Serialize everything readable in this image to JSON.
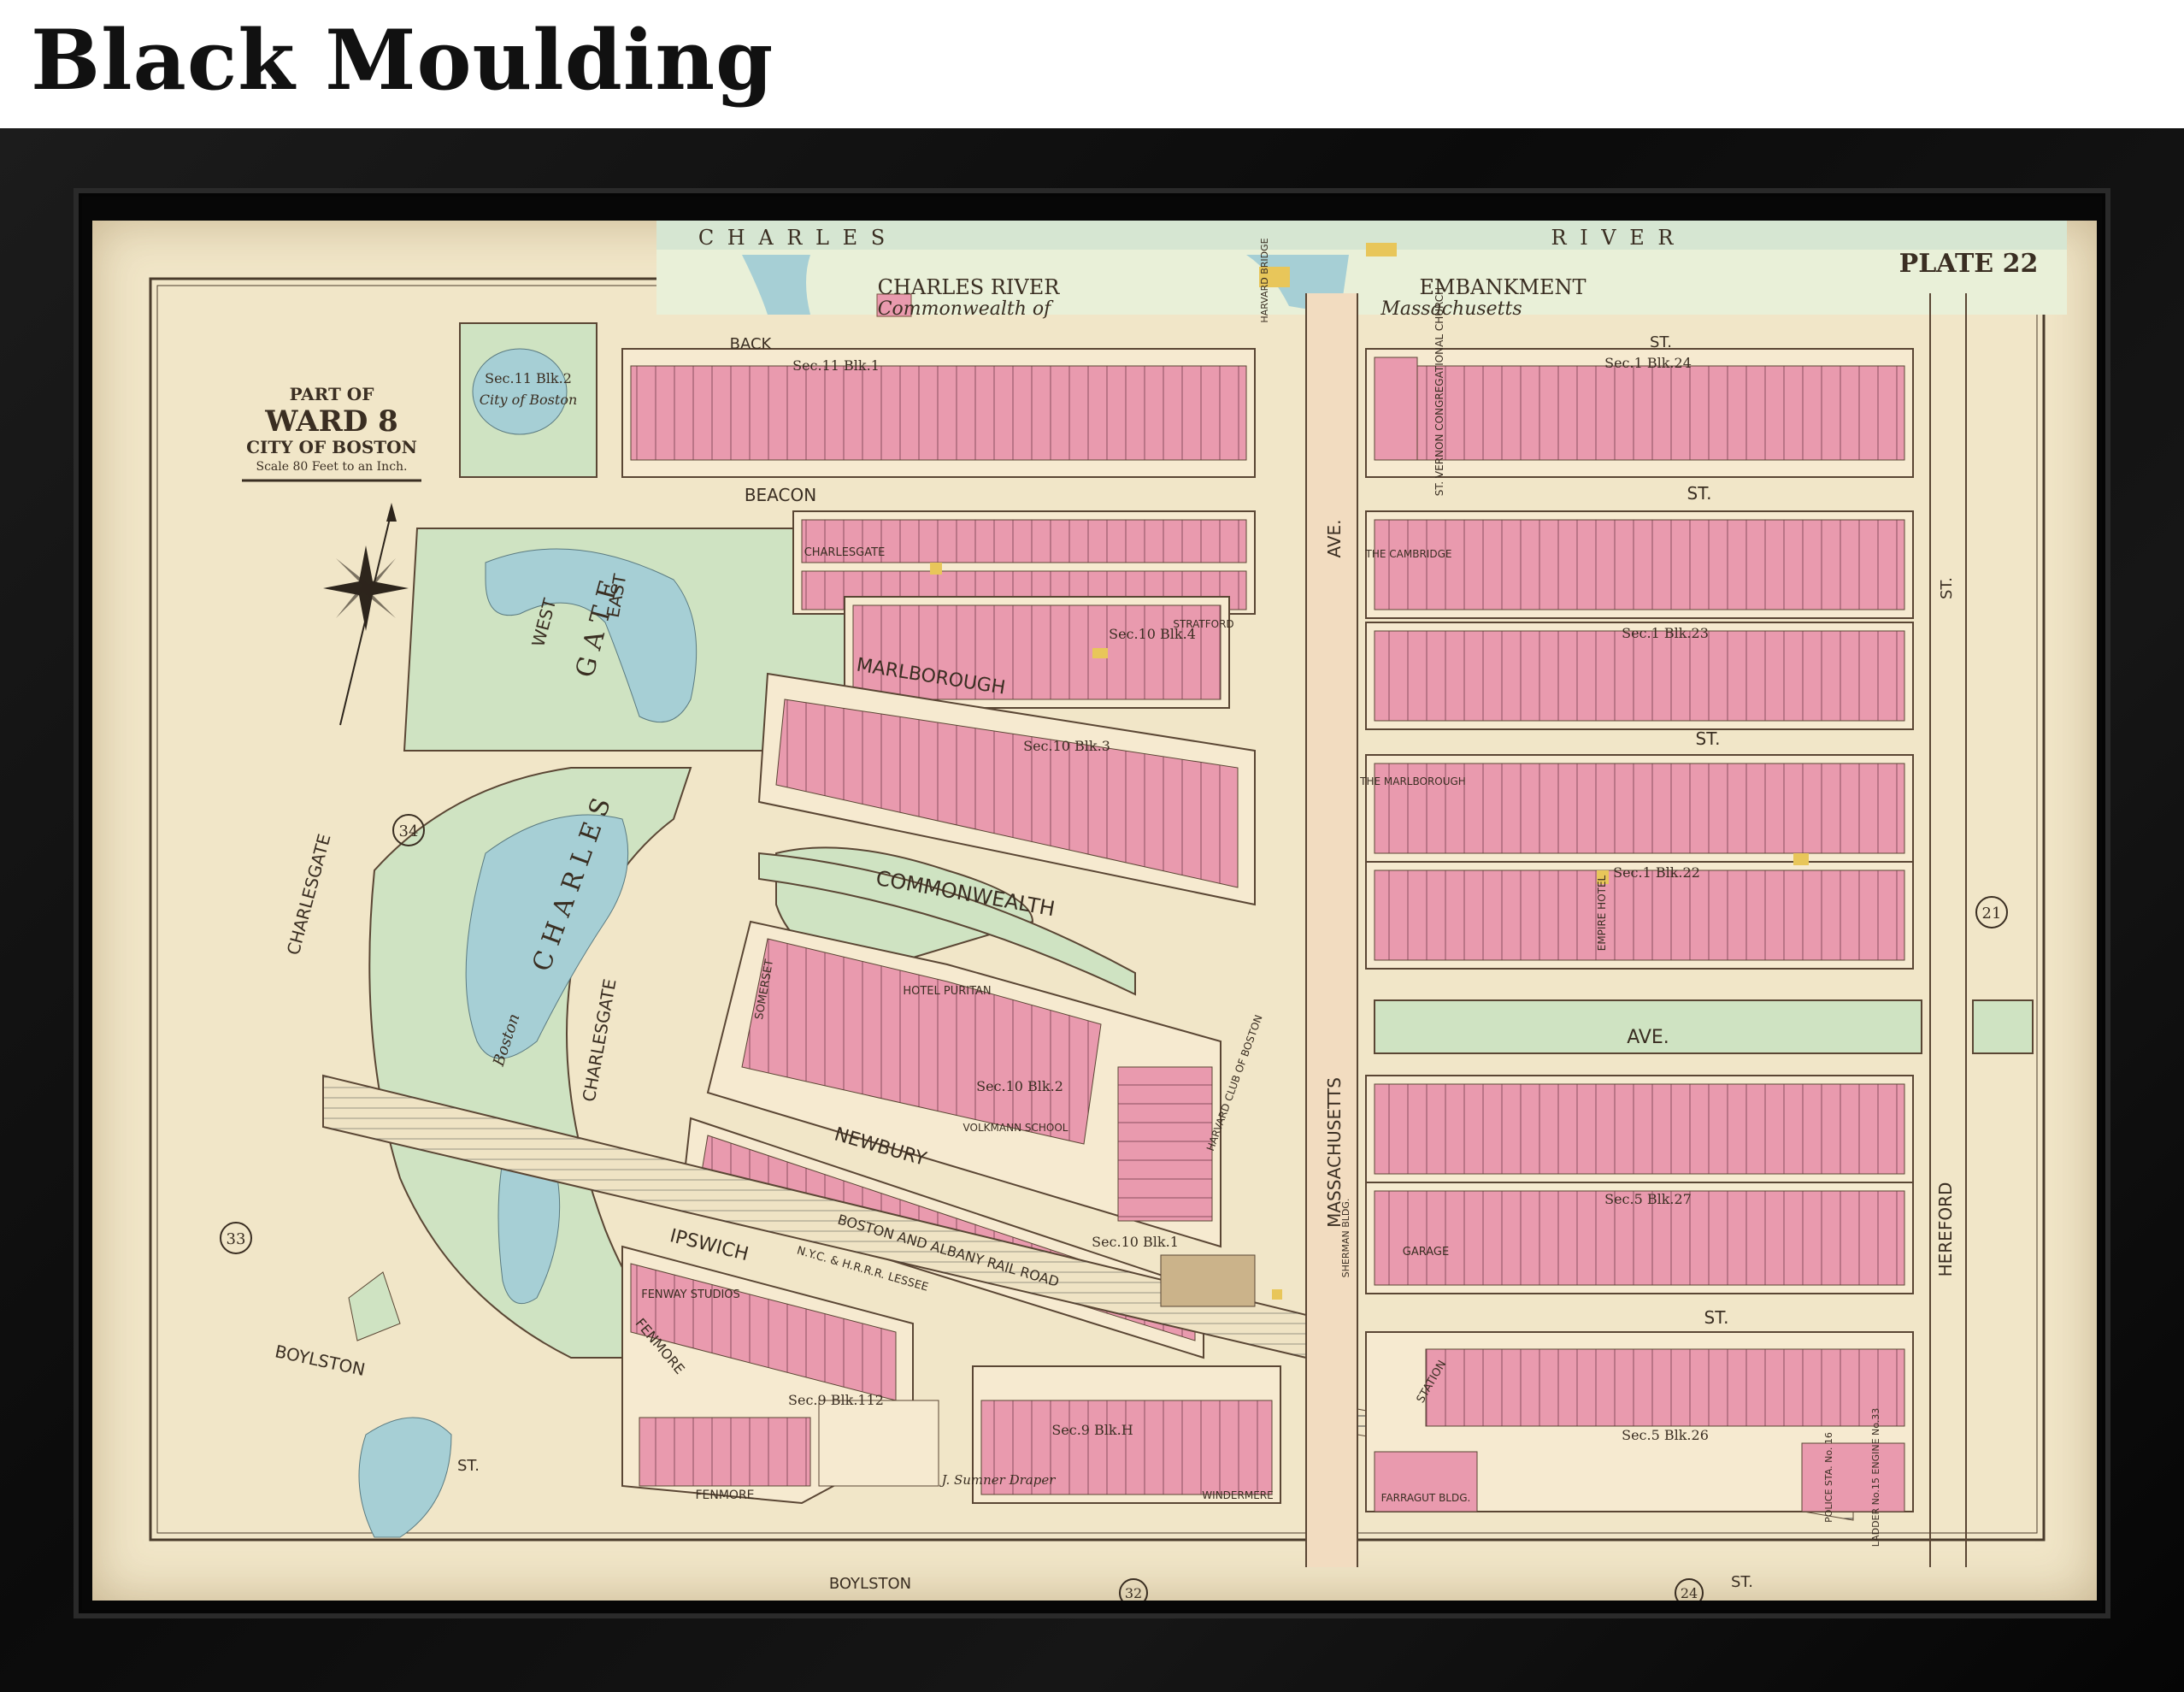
{
  "page": {
    "title": "Black Moulding"
  },
  "map": {
    "plate": "PLATE 22",
    "legend": {
      "part_of": "PART OF",
      "ward": "WARD 8",
      "city": "CITY OF BOSTON",
      "scale": "Scale 80 Feet to an Inch."
    },
    "streets": {
      "charles": "C H A R L E S",
      "river": "R I V E R",
      "charles_river": "CHARLES RIVER",
      "embankment": "EMBANKMENT",
      "commonwealth_of": "Commonwealth of",
      "massachusetts_top": "Massachusetts",
      "back": "BACK",
      "back_st": "ST.",
      "beacon": "BEACON",
      "beacon_st": "ST.",
      "marlborough": "MARLBOROUGH",
      "marlborough_st": "ST.",
      "commonwealth": "COMMONWEALTH",
      "commonwealth_ave": "AVE.",
      "newbury": "NEWBURY",
      "newbury_st": "ST.",
      "boylston_left": "BOYLSTON",
      "boylston_left_st": "ST.",
      "boylston_bottom": "BOYLSTON",
      "boylston_bottom_st": "ST.",
      "ipswich": "IPSWICH",
      "charlesgate_east": "EAST",
      "charlesgate_west": "WEST",
      "charlesgate_road": "CHARLESGATE",
      "charlesgate_mid": "CHARLESGATE",
      "charles_gate_water": "C H A R L E S",
      "gate": "G A T E",
      "massachusetts_ave": "MASSACHUSETTS",
      "mass_ave": "AVE.",
      "hereford": "HEREFORD",
      "hereford_st": "ST.",
      "harvard_bridge": "HARVARD BRIDGE",
      "railroad": "BOSTON AND ALBANY RAIL ROAD",
      "lessee": "N.Y.C. & H.R.R.R. LESSEE",
      "city_of_boston": "City of Boston",
      "boston": "Boston"
    },
    "blocks": {
      "sec11_blk2": "Sec.11 Blk.2",
      "sec11_blk1": "Sec.11 Blk.1",
      "sec1_blk24": "Sec.1 Blk.24",
      "sec10_blk4": "Sec.10 Blk.4",
      "sec1_blk23": "Sec.1 Blk.23",
      "sec10_blk3": "Sec.10 Blk.3",
      "sec1_blk22": "Sec.1 Blk.22",
      "sec10_blk2": "Sec.10 Blk.2",
      "sec5_blk27": "Sec.5 Blk.27",
      "sec10_blk1": "Sec.10 Blk.1",
      "sec9_blk112": "Sec.9 Blk.112",
      "sec9_blkH": "Sec.9 Blk.H",
      "sec5_blk26": "Sec.5 Blk.26"
    },
    "buildings": {
      "st_vernon": "ST. VERNON CONGREGATIONAL CHURCH",
      "charlesgate_bldg": "CHARLESGATE",
      "cambridge": "THE CAMBRIDGE",
      "stratford": "STRATFORD",
      "marlborough_bldg": "THE MARLBOROUGH",
      "empire_hotel": "EMPIRE HOTEL",
      "somerset": "SOMERSET",
      "hotel_puritan": "HOTEL PURITAN",
      "volkmann_school": "VOLKMANN SCHOOL",
      "harvard_club": "HARVARD CLUB OF BOSTON",
      "sherman_bldg": "SHERMAN BLDG.",
      "fenway_studios": "FENWAY STUDIOS",
      "fenmore_top": "FENMORE",
      "fenmore_bottom": "FENMORE",
      "garage": "GARAGE",
      "station": "STATION",
      "farragut_bldg": "FARRAGUT BLDG.",
      "windermere": "WINDERMERE",
      "police_sta": "POLICE STA. No. 16",
      "ladder": "LADDER No.15 ENGINE No.33",
      "j_sumner_draper": "J. Sumner Draper",
      "city_of_boston_lot": "City of Boston"
    },
    "plate_refs": [
      "34",
      "33",
      "21",
      "32",
      "24"
    ]
  }
}
